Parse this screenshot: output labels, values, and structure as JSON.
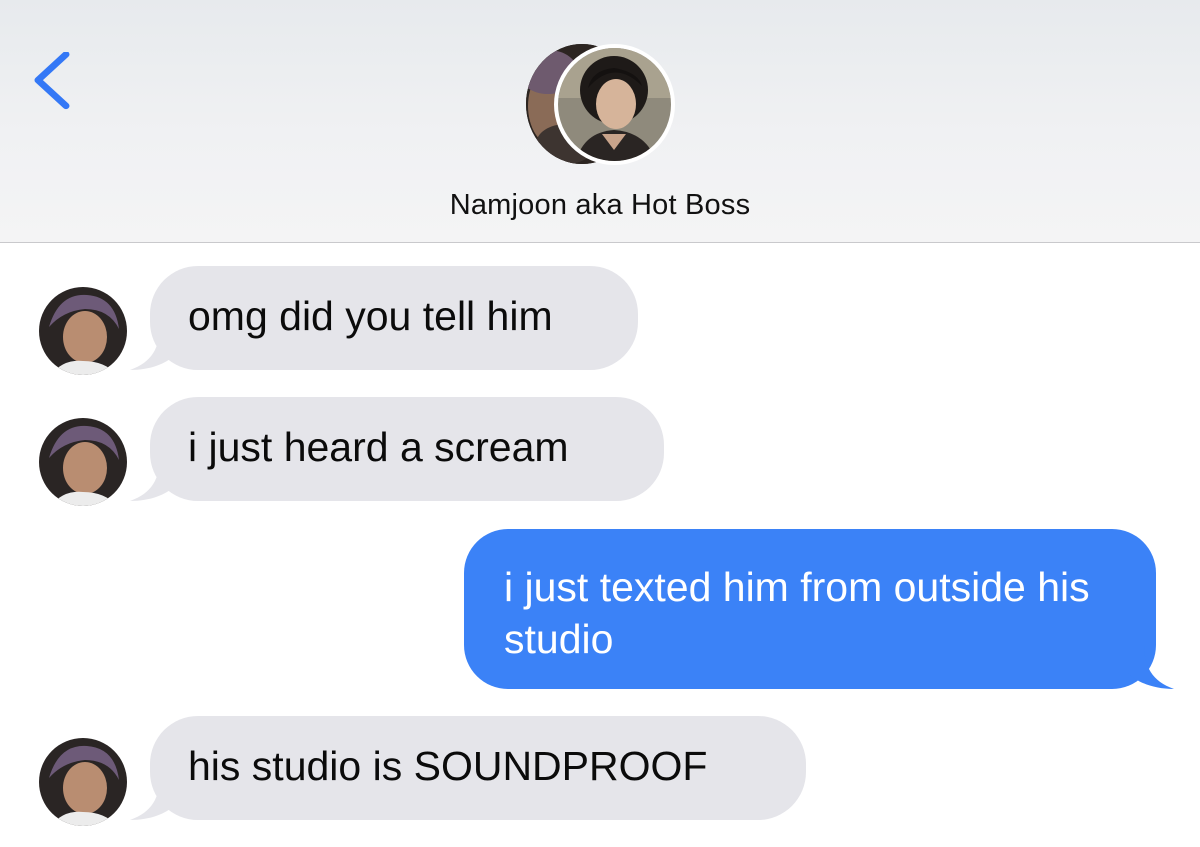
{
  "header": {
    "back_icon": "chevron-left-icon",
    "contact_name": "Namjoon aka Hot Boss",
    "accent_color": "#3478f6"
  },
  "messages": [
    {
      "direction": "incoming",
      "text": "omg did you tell him"
    },
    {
      "direction": "incoming",
      "text": "i just heard a scream"
    },
    {
      "direction": "outgoing",
      "text": "i just texted him from outside his studio"
    },
    {
      "direction": "incoming",
      "text": "his studio is SOUNDPROOF"
    }
  ],
  "colors": {
    "incoming_bubble": "#e5e5ea",
    "outgoing_bubble": "#3b82f7",
    "header_background": "#eef0f2"
  }
}
